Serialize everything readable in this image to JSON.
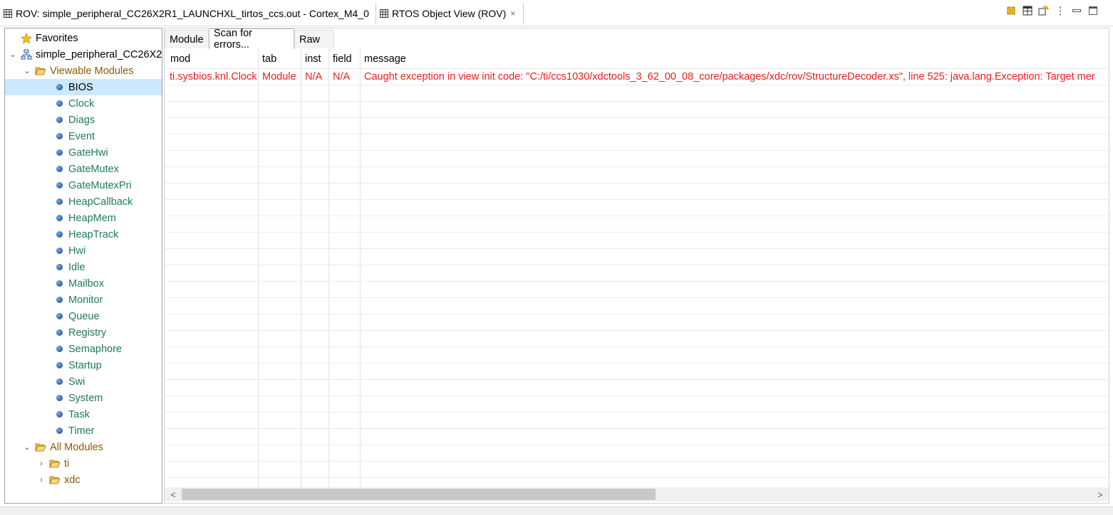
{
  "view_tabs": [
    {
      "label": "ROV: simple_peripheral_CC26X2R1_LAUNCHXL_tirtos_ccs.out - Cortex_M4_0",
      "icon": "grid-icon"
    },
    {
      "label": "RTOS Object View (ROV)",
      "icon": "grid-icon",
      "close_icon": "close-icon",
      "close_glyph": "×"
    }
  ],
  "toolbar": {
    "icons": [
      "pause-icon",
      "table-view-icon",
      "refresh-icon",
      "view-menu-icon",
      "minimize-icon",
      "maximize-icon"
    ],
    "view_menu_glyph": "⋮"
  },
  "tree": {
    "favorites": {
      "label": "Favorites",
      "icon": "star-icon"
    },
    "root": {
      "label": "simple_peripheral_CC26X2",
      "icon": "program-icon",
      "expand_glyph": "⌄"
    },
    "viewable": {
      "label": "Viewable Modules",
      "icon": "folder-open-icon",
      "expand_glyph": "⌄"
    },
    "modules": [
      "BIOS",
      "Clock",
      "Diags",
      "Event",
      "GateHwi",
      "GateMutex",
      "GateMutexPri",
      "HeapCallback",
      "HeapMem",
      "HeapTrack",
      "Hwi",
      "Idle",
      "Mailbox",
      "Monitor",
      "Queue",
      "Registry",
      "Semaphore",
      "Startup",
      "Swi",
      "System",
      "Task",
      "Timer"
    ],
    "selected": "BIOS",
    "all_modules": {
      "label": "All Modules",
      "icon": "folder-open-icon",
      "expand_glyph": "⌄"
    },
    "packages": [
      {
        "label": "ti",
        "icon": "package-folder-icon",
        "expand_glyph": "›"
      },
      {
        "label": "xdc",
        "icon": "package-folder-icon",
        "expand_glyph": "›"
      }
    ]
  },
  "sub_tabs": {
    "module": "Module",
    "scan": "Scan for errors...",
    "raw": "Raw",
    "active": "scan"
  },
  "table": {
    "columns": [
      "mod",
      "tab",
      "inst",
      "field",
      "message"
    ],
    "rows": [
      [
        "ti.sysbios.knl.Clock",
        "Module",
        "N/A",
        "N/A",
        "Caught exception in view init code: \"C:/ti/ccs1030/xdctools_3_62_00_08_core/packages/xdc/rov/StructureDecoder.xs\", line 525: java.lang.Exception: Target mer"
      ]
    ],
    "error_color": "#e8201d"
  },
  "scrollbar": {
    "left_glyph": "<",
    "right_glyph": ">"
  }
}
